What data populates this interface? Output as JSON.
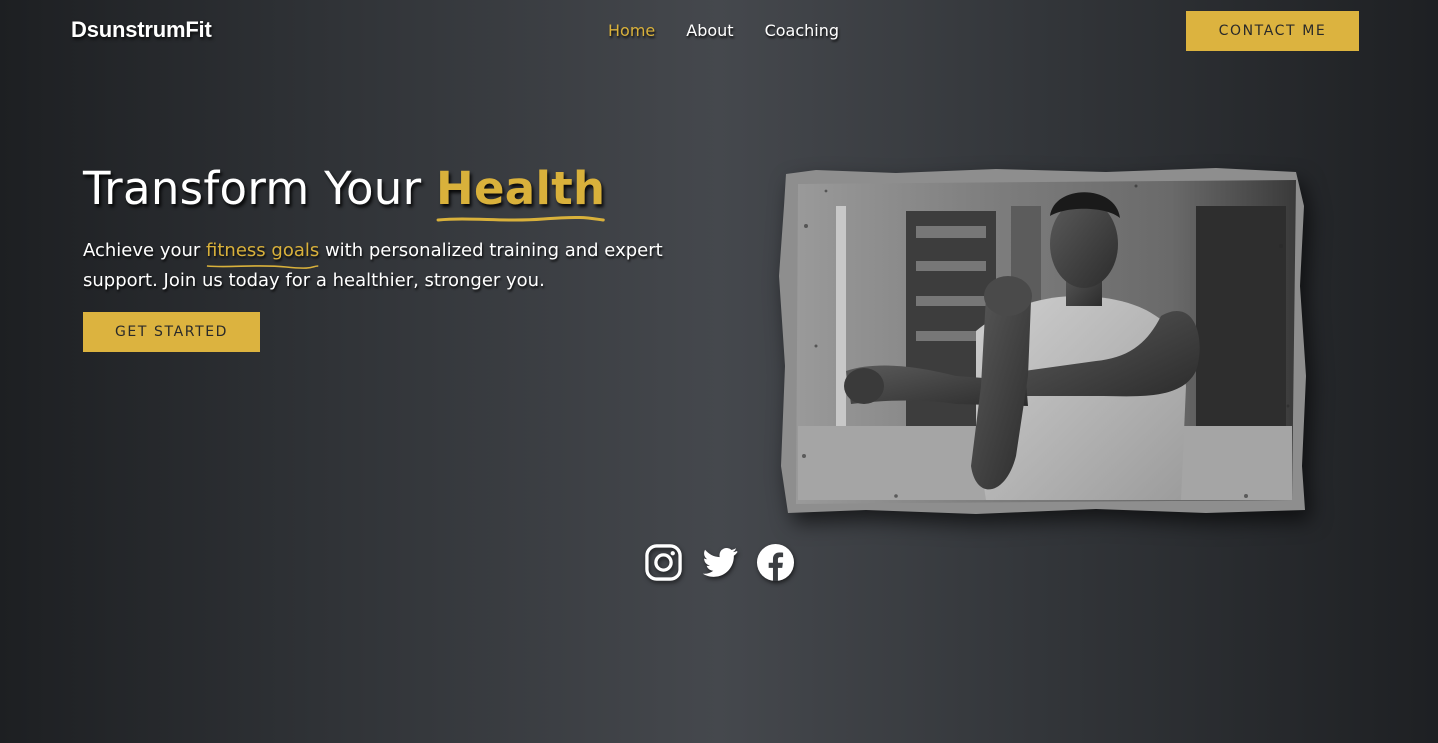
{
  "brand": {
    "name": "DsunstrumFit"
  },
  "nav": {
    "items": [
      {
        "label": "Home",
        "active": true
      },
      {
        "label": "About",
        "active": false
      },
      {
        "label": "Coaching",
        "active": false
      }
    ],
    "contact_label": "CONTACT ME"
  },
  "hero": {
    "headline_prefix": "Transform Your ",
    "headline_accent": "Health",
    "sub_before": "Achieve your ",
    "sub_accent": "fitness goals",
    "sub_after": " with personalized training and expert support. Join us today for a healthier, stronger you.",
    "cta_label": "GET STARTED"
  },
  "photo": {
    "subject": "man stretching arm across chest in a gym"
  },
  "social": {
    "icons": [
      "instagram-icon",
      "twitter-icon",
      "facebook-icon"
    ]
  },
  "colors": {
    "accent": "#dcb33f",
    "text": "#ffffff",
    "background_dark": "#1d1f22",
    "background_light": "#45484d"
  }
}
